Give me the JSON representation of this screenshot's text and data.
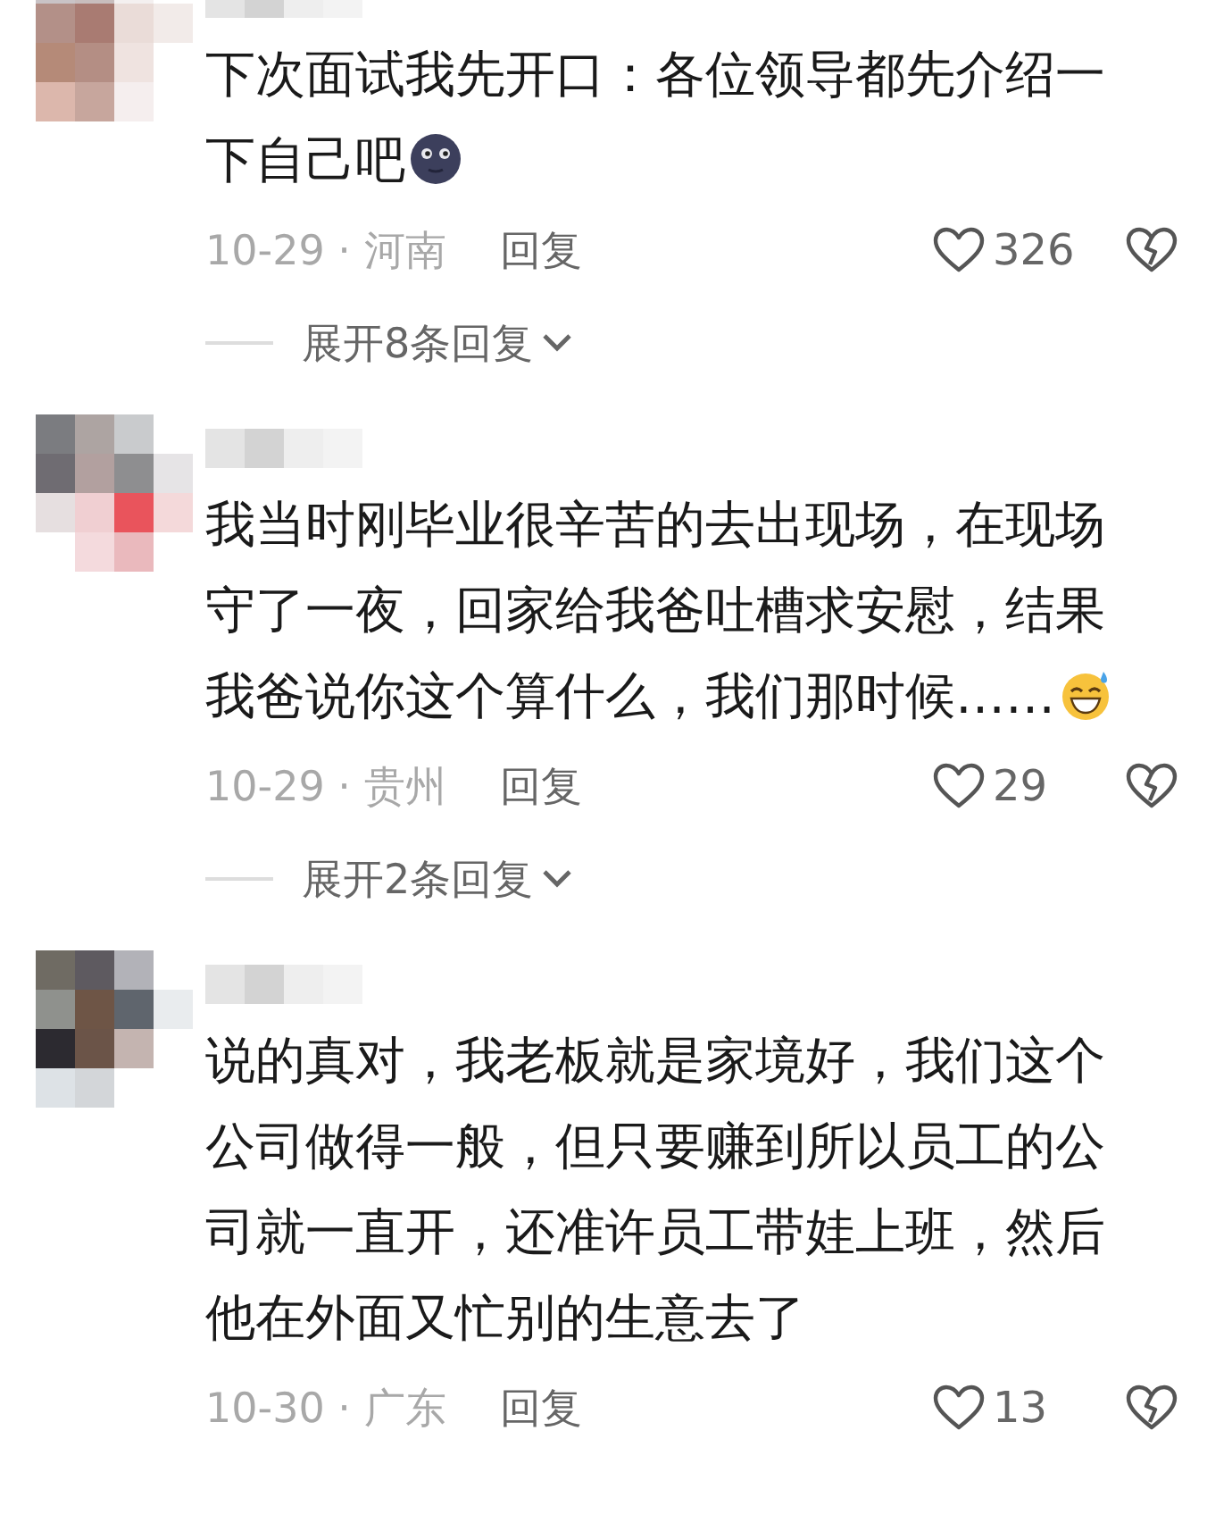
{
  "comments": [
    {
      "text": "下次面试我先开口：各位领导都先介绍一下自己吧",
      "emoji": {
        "kind": "moon-face"
      },
      "meta": "10-29 · 河南",
      "reply": "回复",
      "likes": "326",
      "expand": "展开8条回复"
    },
    {
      "text": "我当时刚毕业很辛苦的去出现场，在现场守了一夜，回家给我爸吐槽求安慰，结果我爸说你这个算什么，我们那时候……",
      "emoji": {
        "kind": "grin-sweat"
      },
      "meta": "10-29 · 贵州",
      "reply": "回复",
      "likes": "29",
      "expand": "展开2条回复"
    },
    {
      "text": "说的真对，我老板就是家境好，我们这个公司做得一般，但只要赚到所以员工的公司就一直开，还准许员工带娃上班，然后他在外面又忙别的生意去了",
      "meta": "10-30 · 广东",
      "reply": "回复",
      "likes": "13"
    }
  ]
}
